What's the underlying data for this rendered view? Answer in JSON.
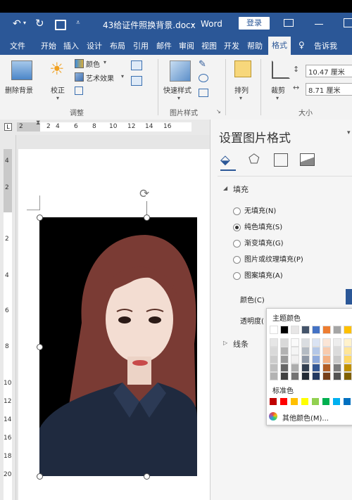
{
  "titlebar": {
    "filename": "43给证件照换背景.docx",
    "separator": "-",
    "app": "Word",
    "login_button": "登录"
  },
  "tabs": [
    "文件",
    "开始",
    "插入",
    "设计",
    "布局",
    "引用",
    "邮件",
    "审阅",
    "视图",
    "开发",
    "帮助",
    "格式"
  ],
  "tell_me": "告诉我",
  "ribbon": {
    "remove_bg": "删除背景",
    "correct": "校正",
    "color": "颜色",
    "artistic": "艺术效果",
    "group_adjust": "调整",
    "quick_styles": "快速样式",
    "group_picture_styles": "图片样式",
    "arrange": "排列",
    "crop": "裁剪",
    "height_value": "10.47 厘米",
    "width_value": "8.71 厘米",
    "group_size": "大小"
  },
  "ruler_numbers": [
    "2",
    "2",
    "4",
    "6",
    "8",
    "10",
    "12",
    "14",
    "16"
  ],
  "vruler_numbers": [
    "4",
    "2",
    "2",
    "4",
    "6",
    "8",
    "10",
    "12",
    "14",
    "16",
    "18",
    "20"
  ],
  "pane": {
    "title": "设置图片格式",
    "section_fill": "填充",
    "options": [
      "无填充(N)",
      "纯色填充(S)",
      "渐变填充(G)",
      "图片或纹理填充(P)",
      "图案填充(A)"
    ],
    "selected_option": 1,
    "color_label": "颜色(C)",
    "transparency_label": "透明度(",
    "section_line": "线条"
  },
  "palette": {
    "theme_colors_label": "主题颜色",
    "standard_colors_label": "标准色",
    "more_colors": "其他颜色(M)...",
    "theme_top": [
      "#ffffff",
      "#000000",
      "#e7e6e6",
      "#44546a",
      "#4472c4",
      "#ed7d31",
      "#a5a5a5",
      "#ffc000"
    ],
    "standard": [
      "#c00000",
      "#ff0000",
      "#ffc000",
      "#ffff00",
      "#92d050",
      "#00b050",
      "#00b0f0",
      "#0070c0"
    ]
  }
}
